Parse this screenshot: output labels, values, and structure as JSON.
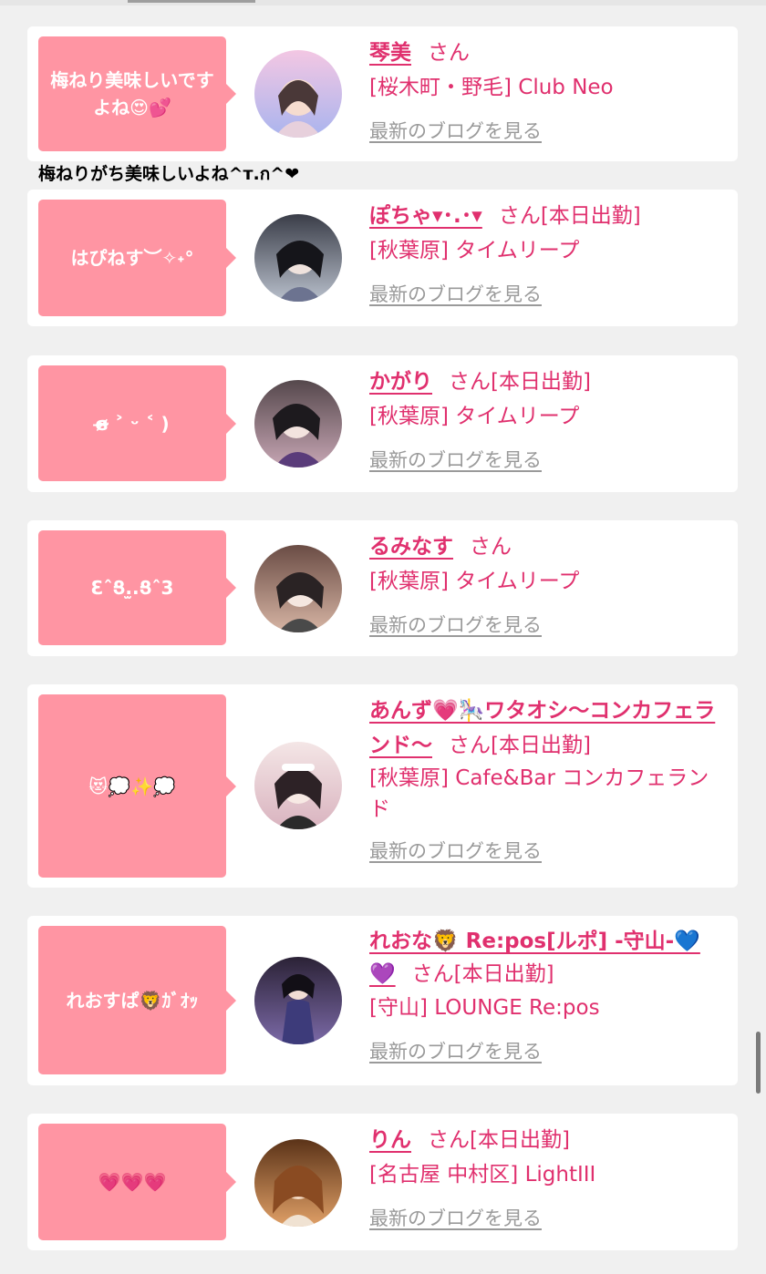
{
  "comment_text": "梅ねりがち美味しいよね^т.ก^❤",
  "blog_link_label": "最新のブログを見る",
  "cards": [
    {
      "bubble": "梅ねり美味しいですよね😍💕",
      "name": "琴美",
      "san": "さん",
      "shop": "[桜木町・野毛] Club Neo",
      "avatar_colors": [
        "#f3c7e3",
        "#a9b4ee"
      ]
    },
    {
      "bubble": "はぴねす︶✧˖°",
      "name": "ぽちゃ▾･.･▾",
      "san": "さん[本日出勤]",
      "shop": "[秋葉原] タイムリープ",
      "avatar_colors": [
        "#3a3d48",
        "#b9c0cc"
      ]
    },
    {
      "bubble": "ɞ̴̶̷ ˃ ᵕ ˂ )",
      "name": "かがり",
      "san": "さん[本日出勤]",
      "shop": "[秋葉原] タイムリープ",
      "avatar_colors": [
        "#55484c",
        "#c7a6b4"
      ]
    },
    {
      "bubble": "ƐˆՑ.̫.Ցˆ3",
      "name": "るみなす",
      "san": "さん",
      "shop": "[秋葉原] タイムリープ",
      "avatar_colors": [
        "#6a4c44",
        "#d7b5a4"
      ]
    },
    {
      "bubble": "😻💭✨💭",
      "name": "あんず💗🎠ワタオシ〜コンカフェランド〜",
      "san": "さん[本日出勤]",
      "shop": "[秋葉原] Cafe&Bar コンカフェランド",
      "avatar_colors": [
        "#f4e6e6",
        "#d9b3bf"
      ]
    },
    {
      "bubble": "れおすぱ🦁ｶﾞｵｯ",
      "name": "れおな🦁 Re:pos[ルポ] -守山-💙💜",
      "san": "さん[本日出勤]",
      "shop": "[守山] LOUNGE Re:pos",
      "avatar_colors": [
        "#2b2236",
        "#7c6aa8"
      ]
    },
    {
      "bubble": "💗💗💗",
      "name": "りん",
      "san": "さん[本日出勤]",
      "shop": "[名古屋 中村区] LightIII",
      "avatar_colors": [
        "#5b3318",
        "#e0a067"
      ]
    }
  ]
}
